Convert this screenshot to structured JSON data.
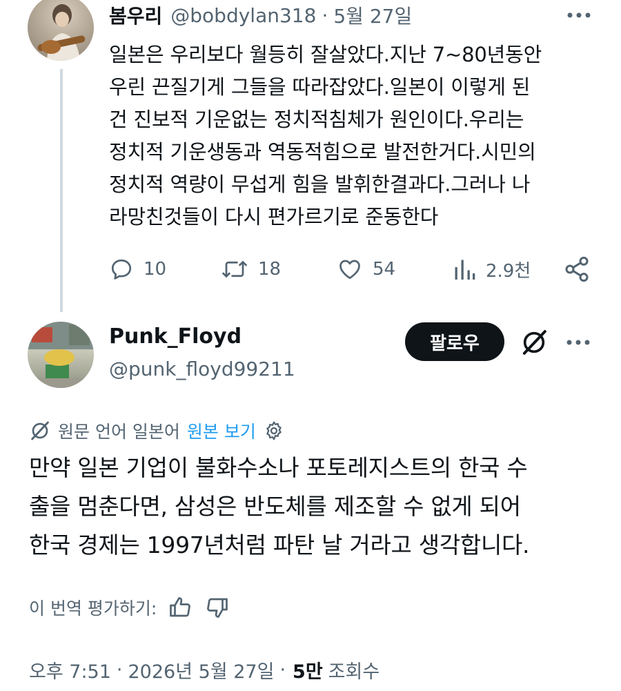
{
  "parent_tweet": {
    "author_name": "봄우리",
    "handle": "@bobdylan318",
    "separator": "·",
    "date": "5월 27일",
    "text": "일본은 우리보다 월등히 잘살았다.지난 7~80년동안\n우린 끈질기게 그들을 따라잡았다.일본이 이렇게 된\n건 진보적 기운없는 정치적침체가 원인이다.우리는\n정치적 기운생동과 역동적힘으로 발전한거다.시민의\n정치적 역량이 무섭게 힘을 발휘한결과다.그러나 나\n라망친것들이 다시 편가르기로 준동한다",
    "actions": {
      "replies": "10",
      "reposts": "18",
      "likes": "54",
      "views": "2.9천"
    }
  },
  "focused_tweet": {
    "author_name": "Punk_Floyd",
    "handle": "@punk_floyd99211",
    "follow_label": "팔로우",
    "translated_notice": "원문 언어 일본어",
    "show_original_label": "원본 보기",
    "text": "만약 일본 기업이 불화수소나 포토레지스트의 한국 수\n출을 멈춘다면, 삼성은 반도체를 제조할 수 없게 되어\n한국 경제는 1997년처럼 파탄 날 거라고 생각합니다.",
    "rate_label": "이 번역 평가하기:",
    "time": "오후 7:51",
    "separator": "·",
    "date": "2026년 5월 27일",
    "views_count": "5만",
    "views_label": "조회수"
  },
  "colors": {
    "text_primary": "#0f1419",
    "text_secondary": "#536471",
    "link": "#1d9bf0",
    "thread_line": "#cfd9de",
    "follow_bg": "#0f1419"
  },
  "icons": {
    "reply": "speech-bubble-icon",
    "repost": "repost-arrows-icon",
    "like": "heart-icon",
    "views": "bar-chart-icon",
    "share": "share-icon",
    "more": "more-dots-icon",
    "grok": "grok-slash-icon",
    "translate": "translate-slash-icon",
    "settings": "gear-icon",
    "thumb_up": "thumbs-up-icon",
    "thumb_down": "thumbs-down-icon"
  }
}
